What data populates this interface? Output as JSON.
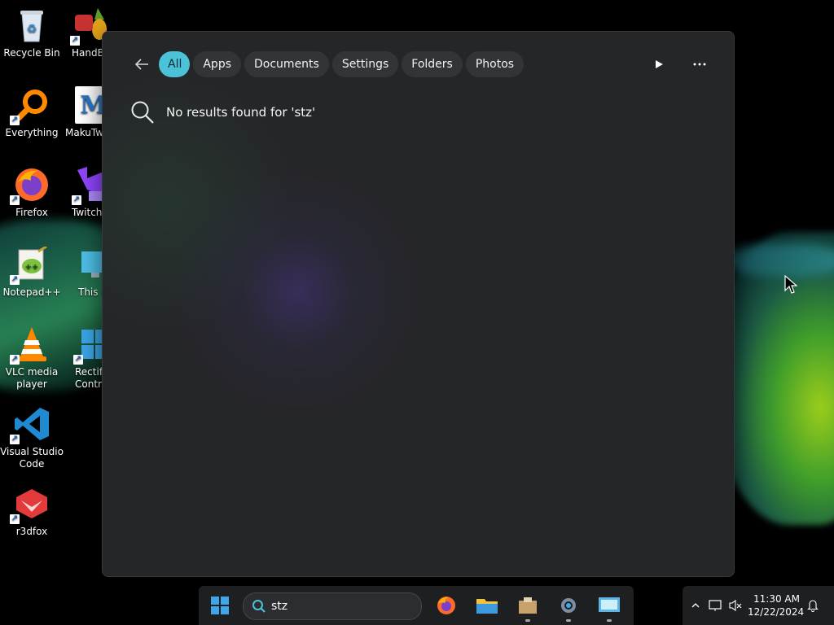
{
  "desktop": {
    "col1": [
      {
        "label": "Recycle Bin",
        "icon": "recycle-bin-icon"
      },
      {
        "label": "Everything",
        "icon": "everything-search-icon"
      },
      {
        "label": "Firefox",
        "icon": "firefox-icon"
      },
      {
        "label": "Notepad++",
        "icon": "notepad-plus-plus-icon"
      },
      {
        "label": "VLC media player",
        "icon": "vlc-icon"
      },
      {
        "label": "Visual Studio Code",
        "icon": "vscode-icon"
      },
      {
        "label": "r3dfox",
        "icon": "r3dfox-icon"
      }
    ],
    "col2": [
      {
        "label": "HandB",
        "icon": "handbrake-icon"
      },
      {
        "label": "MakuTw",
        "icon": "makutweaker-icon"
      },
      {
        "label": "Twitchl",
        "icon": "twitch-icon"
      },
      {
        "label": "This l",
        "icon": "this-pc-icon"
      },
      {
        "label": "Rectify Contr",
        "icon": "rectify11-icon"
      }
    ]
  },
  "search_flyout": {
    "filters": [
      "All",
      "Apps",
      "Documents",
      "Settings",
      "Folders",
      "Photos"
    ],
    "active_filter": "All",
    "no_results_text": "No results found for 'stz'"
  },
  "taskbar": {
    "search_value": "stz",
    "apps": [
      "start-icon",
      "firefox-icon",
      "file-explorer-icon",
      "archive-icon",
      "settings-gear-icon",
      "control-panel-icon"
    ]
  },
  "tray": {
    "time": "11:30 AM",
    "date": "12/22/2024"
  },
  "colors": {
    "accent": "#4cc2d9",
    "flyout_bg": "#252628",
    "taskbar_bg": "#1e1f21"
  }
}
